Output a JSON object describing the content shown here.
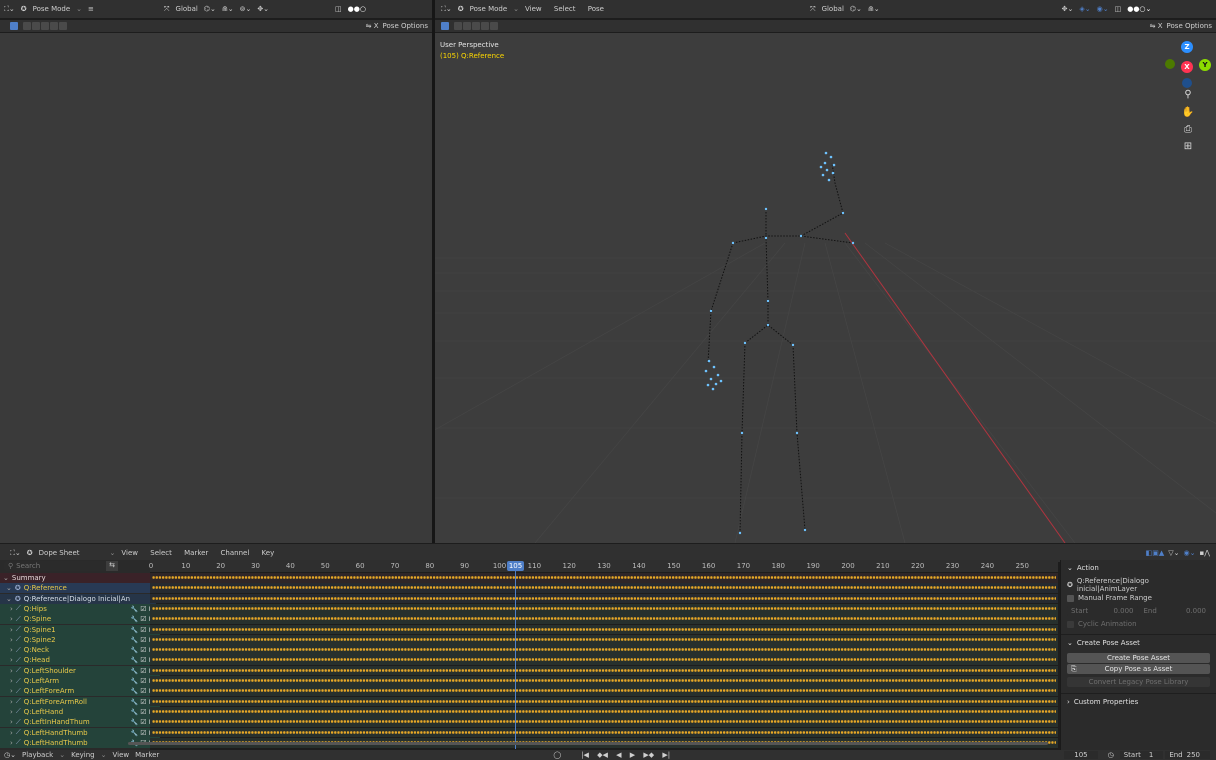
{
  "left_header": {
    "mode": "Pose Mode",
    "orientation": "Global"
  },
  "left_tools": {
    "options": "Pose Options"
  },
  "right_header": {
    "mode": "Pose Mode",
    "menu": [
      "View",
      "Select",
      "Pose"
    ],
    "orientation": "Global"
  },
  "right_tools": {
    "options": "Pose Options"
  },
  "viewport": {
    "perspective": "User Perspective",
    "object_info": "(105) Q:Reference",
    "axes": [
      "Z",
      "X",
      "Y"
    ]
  },
  "dopesheet_header": {
    "editor": "Dope Sheet",
    "menu": [
      "View",
      "Select",
      "Marker",
      "Channel",
      "Key"
    ]
  },
  "search": {
    "placeholder": "Search"
  },
  "timeline": {
    "current_frame": "105",
    "ticks": [
      "0",
      "10",
      "20",
      "30",
      "40",
      "50",
      "60",
      "70",
      "80",
      "90",
      "100",
      "110",
      "120",
      "130",
      "140",
      "150",
      "160",
      "170",
      "180",
      "190",
      "200",
      "210",
      "220",
      "230",
      "240",
      "250"
    ]
  },
  "channels": [
    {
      "label": "Summary",
      "kind": "summary"
    },
    {
      "label": "Q:Reference",
      "kind": "object"
    },
    {
      "label": "Q:Reference|Dialogo Inicial|An",
      "kind": "action"
    },
    {
      "label": "Q:Hips",
      "kind": "group"
    },
    {
      "label": "Q:Spine",
      "kind": "group"
    },
    {
      "label": "Q:Spine1",
      "kind": "group"
    },
    {
      "label": "Q:Spine2",
      "kind": "group"
    },
    {
      "label": "Q:Neck",
      "kind": "group"
    },
    {
      "label": "Q:Head",
      "kind": "group"
    },
    {
      "label": "Q:LeftShoulder",
      "kind": "group"
    },
    {
      "label": "Q:LeftArm",
      "kind": "group"
    },
    {
      "label": "Q:LeftForeArm",
      "kind": "group"
    },
    {
      "label": "Q:LeftForeArmRoll",
      "kind": "group"
    },
    {
      "label": "Q:LeftHand",
      "kind": "group"
    },
    {
      "label": "Q:LeftInHandThum",
      "kind": "group"
    },
    {
      "label": "Q:LeftHandThumb",
      "kind": "group"
    },
    {
      "label": "Q:LeftHandThumb",
      "kind": "group"
    }
  ],
  "sidebar": {
    "action_title": "Action",
    "action_name": "Q:Reference|Dialogo inicial|AnimLayer",
    "manual_frame_range": "Manual Frame Range",
    "start_label": "Start",
    "start_value": "0.000",
    "end_label": "End",
    "end_value": "0.000",
    "cyclic": "Cyclic Animation",
    "pose_asset_title": "Create Pose Asset",
    "create_pose_asset": "Create Pose Asset",
    "copy_pose_as_asset": "Copy Pose as Asset",
    "convert_legacy": "Convert Legacy Pose Library",
    "custom_properties": "Custom Properties"
  },
  "footer": {
    "menu": [
      "Playback",
      "Keying",
      "View",
      "Marker"
    ],
    "frame": "105",
    "start_label": "Start",
    "start_value": "1",
    "end_label": "End",
    "end_value": "250"
  },
  "colors": {
    "accent": "#4f7fc8",
    "keyframe": "#e8a826",
    "x_axis": "#ff3352",
    "y_axis": "#8bdc00",
    "z_axis": "#2c8fff",
    "group_row": "#24433a",
    "summary_row": "#3a2228",
    "object_row": "#283a55"
  }
}
